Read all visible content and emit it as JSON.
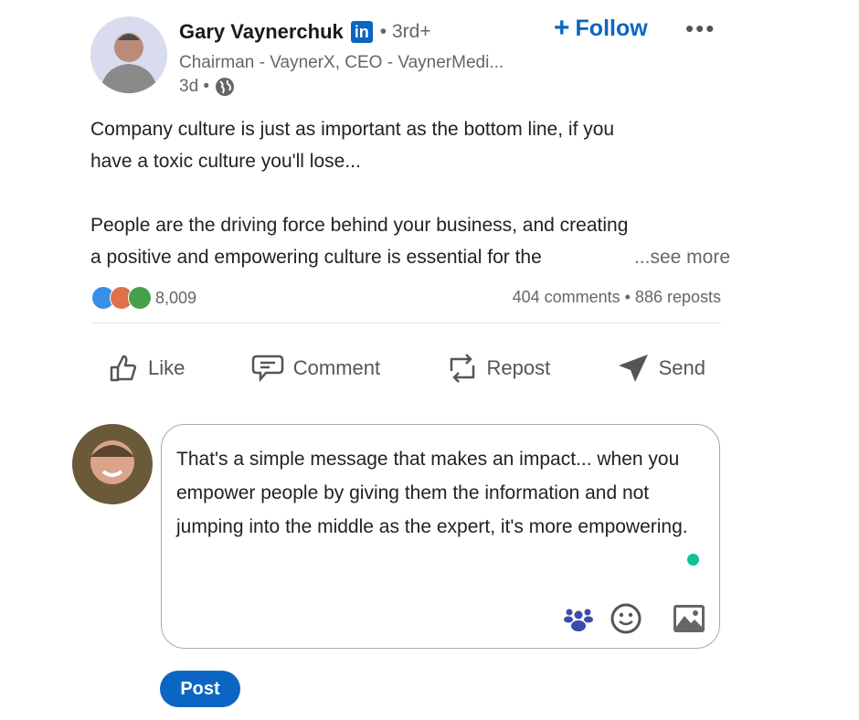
{
  "post": {
    "author": "Gary Vaynerchuk",
    "linkedin_badge": "in",
    "degree": "• 3rd+",
    "headline": "Chairman - VaynerX, CEO - VaynerMedi...",
    "time": "3d •",
    "follow_label": "Follow",
    "more_label": "•••",
    "text_lines": [
      "Company culture is just as important as the bottom line, if you",
      "have a toxic culture you'll lose...",
      "",
      "People are the driving force behind your business, and creating",
      "a positive and empowering culture is essential for the"
    ],
    "see_more": "...see more",
    "reaction_count": "8,009",
    "comments_reposts": "404 comments • 886 reposts"
  },
  "actions": {
    "like": "Like",
    "comment": "Comment",
    "repost": "Repost",
    "send": "Send"
  },
  "comment": {
    "text": "That's a simple message that makes an impact... when you empower people by giving them the information and not jumping into the middle as the expert, it's more empowering.",
    "post_label": "Post"
  },
  "colors": {
    "brand": "#0a66c2",
    "status_dot": "#12c294",
    "group_icon": "#3b4aad"
  }
}
